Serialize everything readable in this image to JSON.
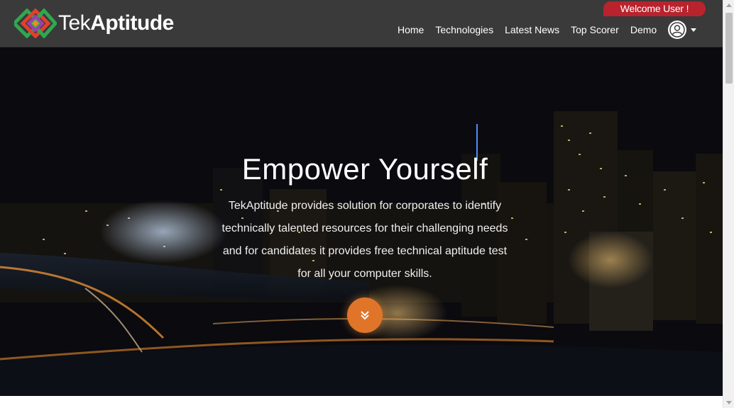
{
  "brand": {
    "name_light": "Tek",
    "name_bold": "Aptitude",
    "logo_icon": "diamond-logo-icon"
  },
  "header": {
    "welcome": "Welcome User !",
    "nav": [
      {
        "label": "Home"
      },
      {
        "label": "Technologies"
      },
      {
        "label": "Latest News"
      },
      {
        "label": "Top Scorer"
      },
      {
        "label": "Demo"
      }
    ],
    "user_icon": "user-avatar-icon"
  },
  "hero": {
    "title": "Empower Yourself",
    "description": "TekAptitude provides solution for corporates to identify technically talented resources for their challenging needs and for candidates it provides free technical aptitude test for all your computer skills.",
    "scroll_icon": "double-chevron-down-icon"
  },
  "colors": {
    "navbar": "#3a3a3a",
    "welcome_badge": "#b8232e",
    "scroll_button": "#e0752a"
  }
}
